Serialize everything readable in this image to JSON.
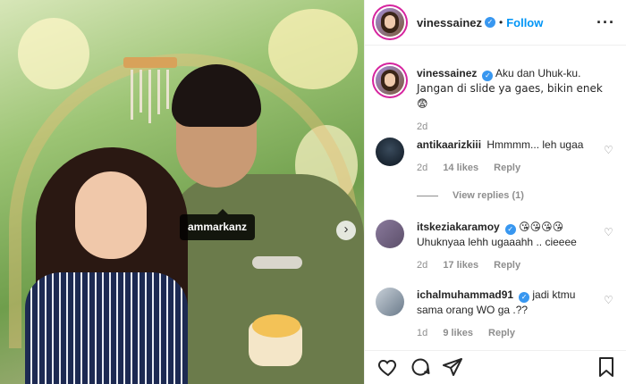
{
  "photo": {
    "tag_label": "ammarkanz",
    "next_icon": "chevron-right-icon"
  },
  "header": {
    "username": "vinessainez",
    "verified": true,
    "separator": "•",
    "follow_label": "Follow",
    "more_icon": "more-options-icon"
  },
  "caption": {
    "username": "vinessainez",
    "text_line1": "Aku dan Uhuk-ku.",
    "text_line2": "Jangan di slide ya gaes, bikin enek 😨",
    "time": "2d"
  },
  "comments": [
    {
      "username": "antikaarizkiii",
      "verified": false,
      "text": "Hmmmm... leh ugaa",
      "time": "2d",
      "likes": "14 likes",
      "reply": "Reply"
    },
    {
      "username": "itskeziakaramoy",
      "verified": true,
      "emojis": "😘😘😘😘",
      "text": "Uhuknyaa lehh ugaaahh .. cieeee",
      "time": "2d",
      "likes": "17 likes",
      "reply": "Reply"
    },
    {
      "username": "ichalmuhammad91",
      "verified": true,
      "text_line1": "jadi ktmu",
      "text_line2": "sama orang WO ga .??",
      "time": "1d",
      "likes": "9 likes",
      "reply": "Reply"
    }
  ],
  "view_replies": "View replies (1)",
  "colors": {
    "follow": "#0095f6",
    "verified": "#3897f0",
    "muted": "#8e8e8e",
    "text": "#262626"
  }
}
